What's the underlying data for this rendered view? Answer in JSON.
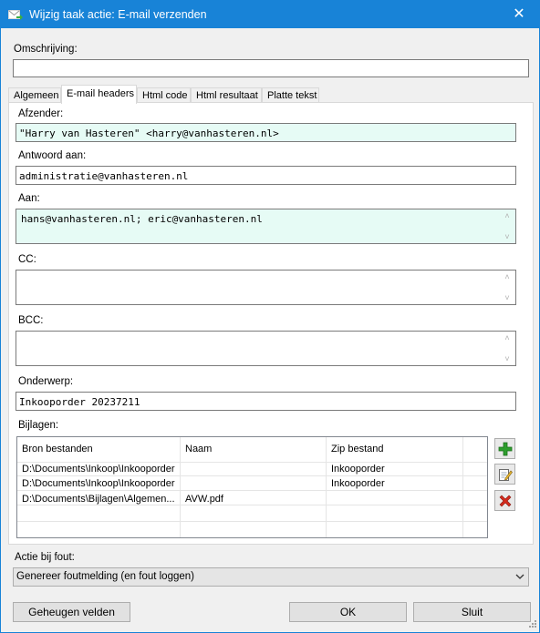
{
  "window": {
    "title": "Wijzig taak actie: E-mail verzenden",
    "close_glyph": "✕"
  },
  "description": {
    "label": "Omschrijving:",
    "value": ""
  },
  "tabs": [
    {
      "label": "Algemeen"
    },
    {
      "label": "E-mail headers"
    },
    {
      "label": "Html code"
    },
    {
      "label": "Html resultaat"
    },
    {
      "label": "Platte tekst"
    }
  ],
  "active_tab": "E-mail headers",
  "headers": {
    "from_label": "Afzender:",
    "from_value": "\"Harry van Hasteren\" <harry@vanhasteren.nl>",
    "reply_label": "Antwoord aan:",
    "reply_value": "administratie@vanhasteren.nl",
    "to_label": "Aan:",
    "to_value": "hans@vanhasteren.nl; eric@vanhasteren.nl",
    "cc_label": "CC:",
    "cc_value": "",
    "bcc_label": "BCC:",
    "bcc_value": "",
    "subject_label": "Onderwerp:",
    "subject_value": "Inkooporder 20237211"
  },
  "attachments": {
    "label": "Bijlagen:",
    "columns": [
      "Bron bestanden",
      "Naam",
      "Zip bestand"
    ],
    "rows": [
      [
        "D:\\Documents\\Inkoop\\Inkooporder",
        "",
        "Inkooporder"
      ],
      [
        "D:\\Documents\\Inkoop\\Inkooporder",
        "",
        "Inkooporder"
      ],
      [
        "D:\\Documents\\Bijlagen\\Algemen...",
        "AVW.pdf",
        ""
      ]
    ]
  },
  "error_action": {
    "label": "Actie bij fout:",
    "value": "Genereer foutmelding (en fout loggen)"
  },
  "buttons": {
    "memory": "Geheugen velden",
    "ok": "OK",
    "close": "Sluit"
  },
  "colors": {
    "titlebar": "#1883d7",
    "required_field": "#e6fbf5",
    "add": "#2e9e2e",
    "delete": "#d42a1c"
  },
  "icons": [
    "mail-arrow-icon",
    "close-icon",
    "scroll-up-icon",
    "scroll-down-icon",
    "add-icon",
    "edit-icon",
    "delete-icon",
    "chevron-down-icon",
    "resize-grip-icon"
  ]
}
